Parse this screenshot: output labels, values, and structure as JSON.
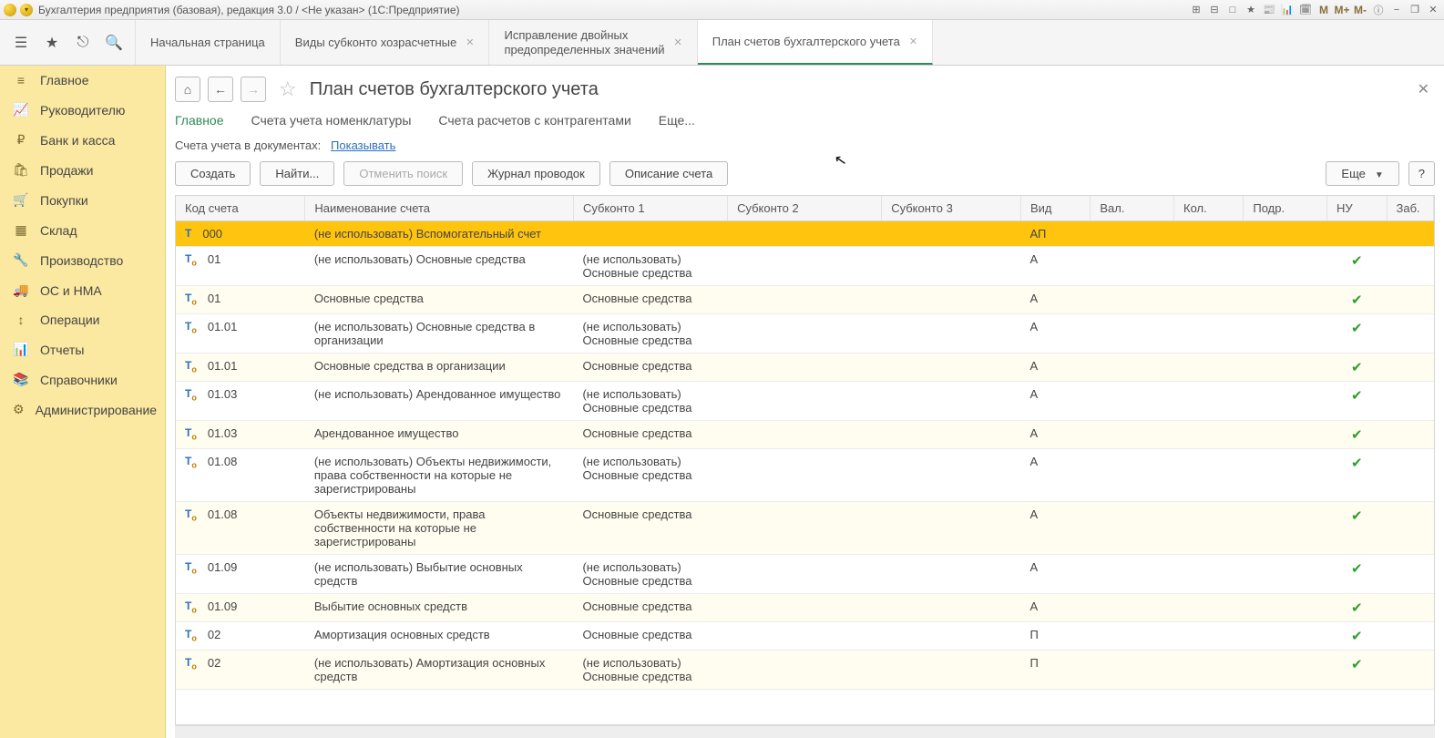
{
  "title_bar": {
    "text": "Бухгалтерия предприятия (базовая), редакция 3.0 / <Не указан>  (1С:Предприятие)",
    "right_icons": [
      "⊞",
      "⊟",
      "□",
      "★",
      "📰",
      "📊",
      "🗓",
      "M",
      "M+",
      "M-",
      "ⓘ",
      "−",
      "❐",
      "✕"
    ]
  },
  "top_icons": [
    "☰",
    "★",
    "⎋",
    "🔍"
  ],
  "tabs": [
    {
      "label": "Начальная страница",
      "closable": false
    },
    {
      "label": "Виды субконто хозрасчетные",
      "closable": true
    },
    {
      "lines": [
        "Исправление двойных",
        "предопределенных значений"
      ],
      "closable": true
    },
    {
      "label": "План счетов бухгалтерского учета",
      "closable": true,
      "active": true
    }
  ],
  "sidebar": [
    {
      "icon": "≡",
      "label": "Главное"
    },
    {
      "icon": "📈",
      "label": "Руководителю"
    },
    {
      "icon": "₽",
      "label": "Банк и касса"
    },
    {
      "icon": "🛍",
      "label": "Продажи"
    },
    {
      "icon": "🛒",
      "label": "Покупки"
    },
    {
      "icon": "▦",
      "label": "Склад"
    },
    {
      "icon": "🔧",
      "label": "Производство"
    },
    {
      "icon": "🚚",
      "label": "ОС и НМА"
    },
    {
      "icon": "↕",
      "label": "Операции"
    },
    {
      "icon": "📊",
      "label": "Отчеты"
    },
    {
      "icon": "📚",
      "label": "Справочники"
    },
    {
      "icon": "⚙",
      "label": "Администрирование"
    }
  ],
  "header": {
    "title": "План счетов бухгалтерского учета"
  },
  "subnav": [
    {
      "label": "Главное",
      "active": true
    },
    {
      "label": "Счета учета номенклатуры"
    },
    {
      "label": "Счета расчетов с контрагентами"
    },
    {
      "label": "Еще..."
    }
  ],
  "docline": {
    "prefix": "Счета учета в документах:",
    "link": "Показывать"
  },
  "toolbar": {
    "create": "Создать",
    "find": "Найти...",
    "cancel": "Отменить поиск",
    "journal": "Журнал проводок",
    "desc": "Описание счета",
    "more": "Еще",
    "help": "?"
  },
  "columns": {
    "code": "Код счета",
    "name": "Наименование счета",
    "s1": "Субконто 1",
    "s2": "Субконто 2",
    "s3": "Субконто 3",
    "vid": "Вид",
    "val": "Вал.",
    "kol": "Кол.",
    "podr": "Подр.",
    "nu": "НУ",
    "zab": "Заб."
  },
  "rows": [
    {
      "icon": "T",
      "code": "000",
      "name": "(не использовать) Вспомогательный счет",
      "s1": "",
      "vid": "АП",
      "nu": false,
      "selected": true
    },
    {
      "icon": "T.",
      "code": "01",
      "name": "(не использовать) Основные средства",
      "s1": "(не использовать)\nОсновные средства",
      "vid": "А",
      "nu": true
    },
    {
      "icon": "T.",
      "code": "01",
      "name": "Основные средства",
      "s1": "Основные средства",
      "vid": "А",
      "nu": true,
      "alt": true
    },
    {
      "icon": "T.",
      "code": "01.01",
      "name": "(не использовать) Основные средства в организации",
      "s1": "(не использовать)\nОсновные средства",
      "vid": "А",
      "nu": true
    },
    {
      "icon": "T.",
      "code": "01.01",
      "name": "Основные средства в организации",
      "s1": "Основные средства",
      "vid": "А",
      "nu": true,
      "alt": true
    },
    {
      "icon": "T.",
      "code": "01.03",
      "name": "(не использовать) Арендованное имущество",
      "s1": "(не использовать)\nОсновные средства",
      "vid": "А",
      "nu": true
    },
    {
      "icon": "T.",
      "code": "01.03",
      "name": "Арендованное имущество",
      "s1": "Основные средства",
      "vid": "А",
      "nu": true,
      "alt": true
    },
    {
      "icon": "T.",
      "code": "01.08",
      "name": "(не использовать) Объекты недвижимости, права собственности на которые не зарегистрированы",
      "s1": "(не использовать)\nОсновные средства",
      "vid": "А",
      "nu": true
    },
    {
      "icon": "T.",
      "code": "01.08",
      "name": "Объекты недвижимости, права собственности на которые не зарегистрированы",
      "s1": "Основные средства",
      "vid": "А",
      "nu": true,
      "alt": true
    },
    {
      "icon": "T.",
      "code": "01.09",
      "name": "(не использовать) Выбытие основных средств",
      "s1": "(не использовать)\nОсновные средства",
      "vid": "А",
      "nu": true
    },
    {
      "icon": "T.",
      "code": "01.09",
      "name": "Выбытие основных средств",
      "s1": "Основные средства",
      "vid": "А",
      "nu": true,
      "alt": true
    },
    {
      "icon": "T.",
      "code": "02",
      "name": "Амортизация основных средств",
      "s1": "Основные средства",
      "vid": "П",
      "nu": true
    },
    {
      "icon": "T.",
      "code": "02",
      "name": "(не использовать) Амортизация основных средств",
      "s1": "(не использовать)\nОсновные средства",
      "vid": "П",
      "nu": true,
      "alt": true
    }
  ]
}
